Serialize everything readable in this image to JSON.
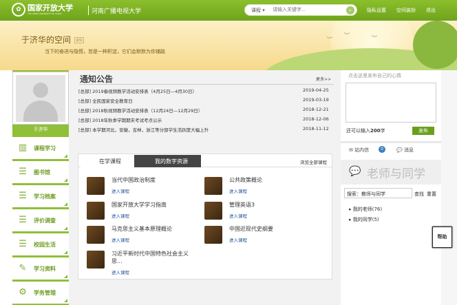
{
  "header": {
    "logo_title": "国家开放大学",
    "logo_sub": "THE OPEN UNIVERSITY OF CHINA",
    "school": "河南广播电视大学",
    "search": {
      "select": "课程",
      "placeholder": "请输入关键字..."
    },
    "links": [
      "隐私设置",
      "空间装扮",
      "退出"
    ]
  },
  "banner": {
    "user_space": "于济华的空间",
    "tag": "编辑",
    "motto": "当下的奋进与隐慌，皆是一种积淀，它们会默默为你铺路"
  },
  "profile": {
    "name": "于济华"
  },
  "sidebar": {
    "items": [
      {
        "label": "课程学习",
        "icon": "book-icon"
      },
      {
        "label": "图书馆",
        "icon": "grid-icon"
      },
      {
        "label": "学习档案",
        "icon": "grid-icon"
      },
      {
        "label": "评价调查",
        "icon": "grid-icon"
      },
      {
        "label": "校园生活",
        "icon": "grid-icon"
      },
      {
        "label": "学习资料",
        "icon": "edit-icon"
      },
      {
        "label": "学务管理",
        "icon": "gear-icon"
      }
    ]
  },
  "notice": {
    "title": "通知公告",
    "more": "更多>>",
    "rows": [
      {
        "text": "[总部] 2019春视频教学活动安排表（4月25日—4月30日）",
        "date": "2019-04-25"
      },
      {
        "text": "[总部] 全民国家安全教育日",
        "date": "2019-03-19"
      },
      {
        "text": "[总部] 2018秋视频教学活动安排表（12月24日—12月29日）",
        "date": "2018-12-21"
      },
      {
        "text": "[总部] 2018年秋季学期期末考试考点公示",
        "date": "2018-12-06"
      },
      {
        "text": "[总部] 本学期河北，安徽，吉林，浙江等分部学生活跃度大幅上升",
        "date": "2018-11-12"
      }
    ]
  },
  "courses": {
    "tab_active": "在学课程",
    "tab_other": "我的数字资源",
    "browse": "浏览全部课程",
    "enter_label": "进入课程",
    "items": [
      "当代中国政治制度",
      "公共政策概论",
      "国家开放大学学习指南",
      "管理英语3",
      "马克思主义基本原理概论",
      "中国近现代史纲要",
      "习近平新时代中国特色社会主义思..."
    ]
  },
  "right": {
    "msg_placeholder": "点击这里发布自己的心情",
    "limit_prefix": "还可以输入",
    "limit_num": "200",
    "limit_suffix": "字",
    "publish": "发布",
    "inbox": "站内信",
    "inbox_count": "0",
    "message": "消息",
    "ts_title": "老师与同学",
    "search_value": "搜索：教师与同学",
    "search_btn": "查找",
    "reset_btn": "重置",
    "tree": [
      "我的老师(76)",
      "我的同学(5)"
    ]
  },
  "help": "帮助"
}
